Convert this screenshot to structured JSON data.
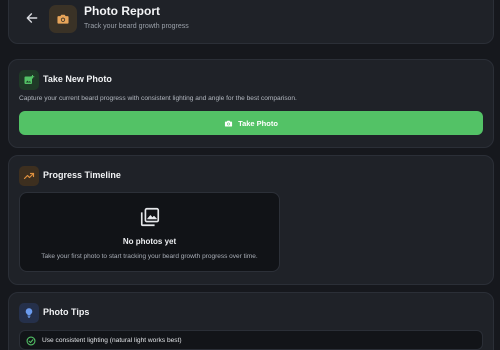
{
  "header": {
    "title": "Photo Report",
    "subtitle": "Track your beard growth progress"
  },
  "take_photo": {
    "title": "Take New Photo",
    "description": "Capture your current beard progress with consistent lighting and angle for the best comparison.",
    "button_label": "Take Photo"
  },
  "timeline": {
    "title": "Progress Timeline",
    "empty_title": "No photos yet",
    "empty_description": "Take your first photo to start tracking your beard growth progress over time."
  },
  "tips": {
    "title": "Photo Tips",
    "items": [
      "Use consistent lighting (natural light works best)"
    ]
  },
  "colors": {
    "background": "#16181d",
    "card": "#1f2228",
    "accent_green": "#53c266",
    "camera_orange": "#e8a55a",
    "chart_orange": "#e0913f",
    "bulb_blue": "#6b9cf0"
  },
  "icons": {
    "back": "arrow-left-icon",
    "header": "camera-icon",
    "take_photo": "add-photo-icon",
    "button": "camera-icon",
    "timeline": "trending-up-icon",
    "empty": "photo-library-icon",
    "tips": "lightbulb-icon",
    "tip_item": "check-circle-icon"
  }
}
